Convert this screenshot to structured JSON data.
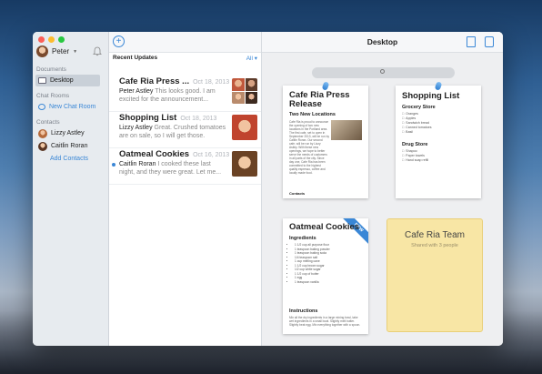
{
  "sidebar": {
    "user_name": "Peter",
    "sections": {
      "documents": "Documents",
      "chat_rooms": "Chat Rooms",
      "contacts": "Contacts"
    },
    "documents_items": [
      {
        "label": "Desktop"
      }
    ],
    "chat_rooms_items": [
      {
        "label": "New Chat Room"
      }
    ],
    "contacts_items": [
      {
        "label": "Lizzy Astley"
      },
      {
        "label": "Caitlin Roran"
      }
    ],
    "add_contacts": "Add Contacts"
  },
  "middle": {
    "recent_title": "Recent Updates",
    "filter": "All",
    "conversations": [
      {
        "title": "Cafe Ria Press ...",
        "date": "Oct 18, 2013",
        "author": "Peter Astley",
        "preview": "This looks good. I am excited for the announcement..."
      },
      {
        "title": "Shopping List",
        "date": "Oct 18, 2013",
        "author": "Lizzy Astley",
        "preview": "Great. Crushed tomatoes are on sale, so I will get those."
      },
      {
        "title": "Oatmeal Cookies",
        "date": "Oct 16, 2013",
        "author": "Caitlin Roran",
        "preview": "I cooked these last night, and they were great. Let me..."
      }
    ]
  },
  "desk": {
    "title": "Desktop",
    "notes": {
      "press": {
        "title": "Cafe Ria Press Release",
        "subtitle": "Two New Locations",
        "body": "Cafe Ria is proud to announce the opening of two new locations in the Portland area. The first cafe, set to open in September 2013, will be run by Caitlin Roran. Our second cafe, will be run by Lizzy Astley. With these new openings, we hope to better serve the needs of customers in all parts of the city. Since day one, Cafe Ria has been committed to the highest quality espresso, coffee and locally made food.",
        "contacts_label": "Contacts"
      },
      "shopping": {
        "title": "Shopping List",
        "grocery_title": "Grocery Store",
        "grocery": [
          "Oranges",
          "Apples",
          "Sandwich bread",
          "Canned tomatoes",
          "Basil"
        ],
        "drug_title": "Drug Store",
        "drug": [
          "Shapoo",
          "Paper towels",
          "Hand soap refill"
        ]
      },
      "cookies": {
        "title": "Oatmeal Cookies",
        "badge": "NEW",
        "ingredients_title": "Ingredients",
        "ingredients": [
          "1 1/2 cup all purpose flour",
          "1 teaspoon baking powder",
          "1 teaspoon baking soda",
          "1/4 teaspoon salt",
          "1 cup melting cane",
          "1 1/2 cup brown sugar",
          "1/2 cup white sugar",
          "1 1/2 cup of butter",
          "1 egg",
          "1 teaspoon vanilla"
        ],
        "instructions_title": "Instructions",
        "instructions": "Mix all the dry ingredients in a large mixing bowl, take wet ingredients in a small bowl. Slightly melt butter. Slightly beat egg. Mix everything together with a spoon."
      },
      "team": {
        "title": "Cafe Ria Team",
        "subtitle": "Shared with 3 people"
      }
    }
  },
  "colors": {
    "accent": "#3a87d6",
    "folder": "#f8e6a5",
    "unread": "#3a87d6"
  }
}
